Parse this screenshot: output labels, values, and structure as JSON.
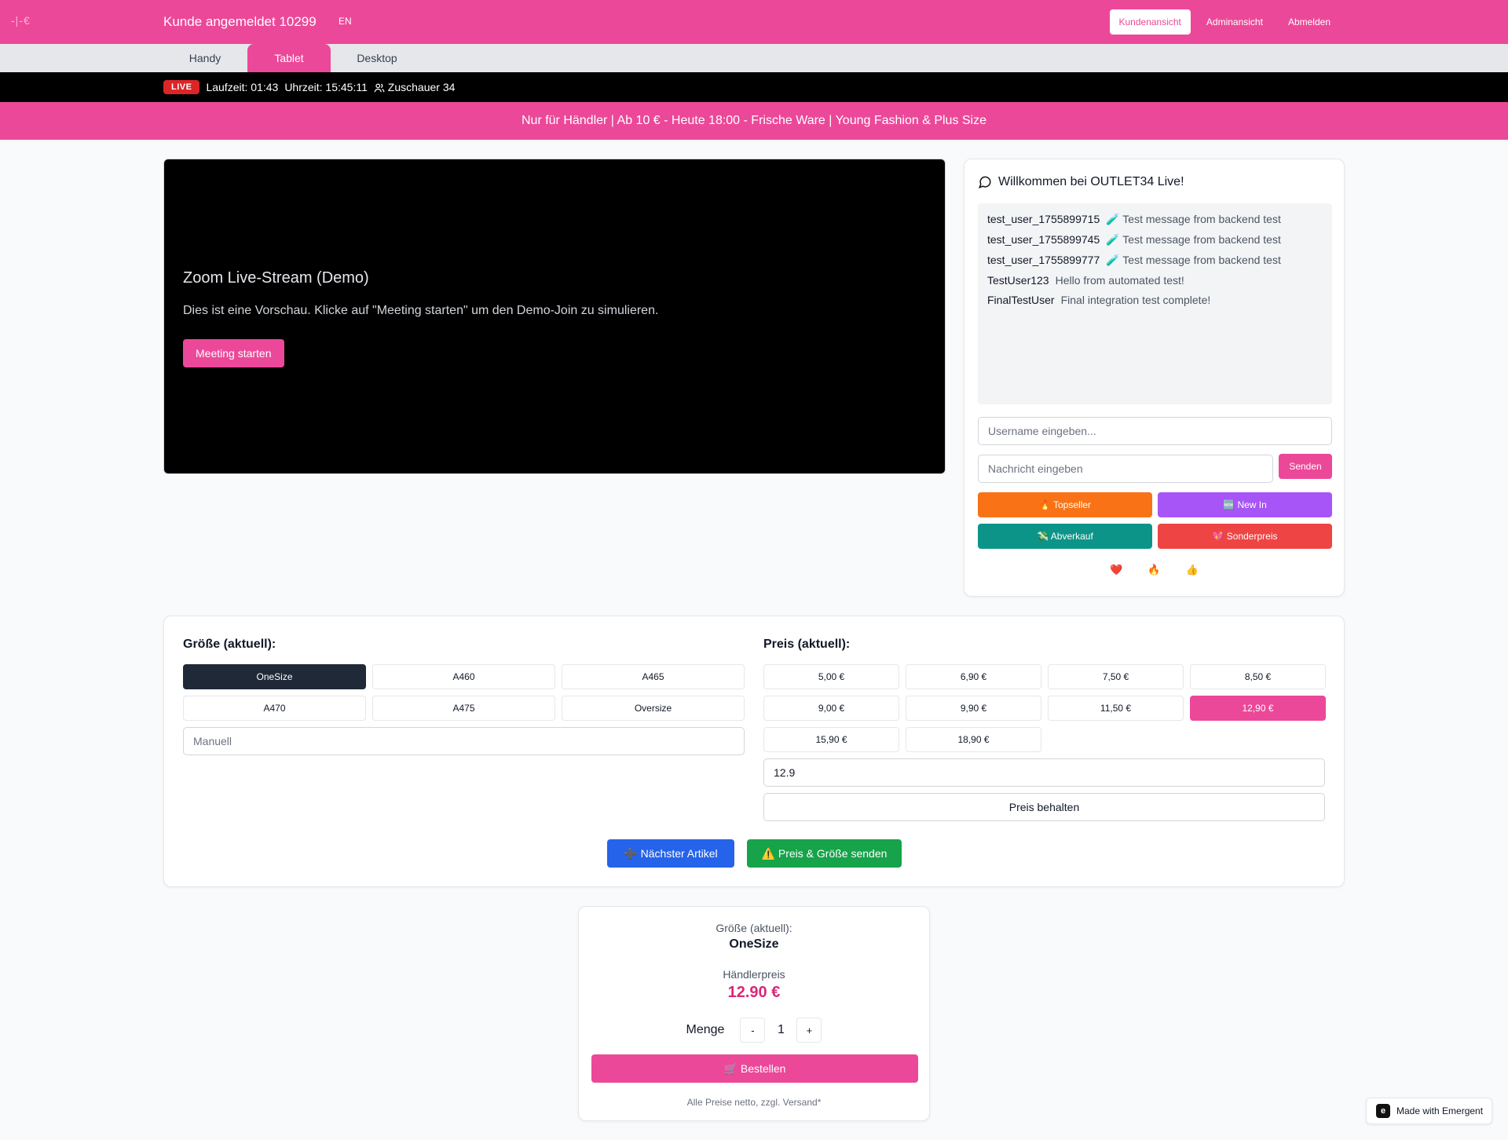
{
  "header": {
    "logo_text": "-|-€",
    "brand": "Kunde angemeldet 10299",
    "lang": "EN",
    "nav": [
      "Kundenansicht",
      "Adminansicht",
      "Abmelden"
    ]
  },
  "tabs": [
    "Handy",
    "Tablet",
    "Desktop"
  ],
  "livebar": {
    "badge": "LIVE",
    "runtime": "Laufzeit: 01:43",
    "time": "Uhrzeit: 15:45:11",
    "viewers": "Zuschauer 34"
  },
  "promo": "Nur für Händler | Ab 10 € - Heute 18:00 - Frische Ware | Young Fashion & Plus Size",
  "video": {
    "title": "Zoom Live-Stream (Demo)",
    "description": "Dies ist eine Vorschau. Klicke auf \"Meeting starten\" um den Demo-Join zu simulieren.",
    "button": "Meeting starten"
  },
  "chat": {
    "title": "Willkommen bei OUTLET34 Live!",
    "messages": [
      {
        "user": "test_user_1755899715",
        "text": "🧪 Test message from backend test"
      },
      {
        "user": "test_user_1755899745",
        "text": "🧪 Test message from backend test"
      },
      {
        "user": "test_user_1755899777",
        "text": "🧪 Test message from backend test"
      },
      {
        "user": "TestUser123",
        "text": "Hello from automated test!"
      },
      {
        "user": "FinalTestUser",
        "text": "Final integration test complete!"
      }
    ],
    "username_placeholder": "Username eingeben...",
    "message_placeholder": "Nachricht eingeben",
    "send": "Senden",
    "quick": [
      {
        "label": "🔥 Topseller",
        "color": "#f97316"
      },
      {
        "label": "🆕 New In",
        "color": "#a855f7"
      },
      {
        "label": "💸 Abverkauf",
        "color": "#0d9488"
      },
      {
        "label": "💖 Sonderpreis",
        "color": "#ef4444"
      }
    ],
    "reactions": [
      "❤️",
      "🔥",
      "👍"
    ]
  },
  "sizes": {
    "title": "Größe (aktuell):",
    "options": [
      "OneSize",
      "A460",
      "A465",
      "A470",
      "A475",
      "Oversize"
    ],
    "selected": "OneSize",
    "manual_placeholder": "Manuell"
  },
  "prices": {
    "title": "Preis (aktuell):",
    "options": [
      "5,00 €",
      "6,90 €",
      "7,50 €",
      "8,50 €",
      "9,00 €",
      "9,90 €",
      "11,50 €",
      "12,90 €",
      "15,90 €",
      "18,90 €"
    ],
    "selected": "12,90 €",
    "input_value": "12.9",
    "keep": "Preis behalten"
  },
  "actions": {
    "next": "➕ Nächster Artikel",
    "send": "⚠️ Preis & Größe senden"
  },
  "order": {
    "size_label": "Größe (aktuell):",
    "size_value": "OneSize",
    "price_label": "Händlerpreis",
    "price_value": "12.90 €",
    "qty_label": "Menge",
    "minus": "-",
    "qty": "1",
    "plus": "+",
    "button": "🛒 Bestellen",
    "note": "Alle Preise netto, zzgl. Versand*"
  },
  "badge": "Made with Emergent",
  "colors": {
    "brand": "#ec4899",
    "live": "#dc2626",
    "next": "#2563eb",
    "send": "#16a34a"
  }
}
